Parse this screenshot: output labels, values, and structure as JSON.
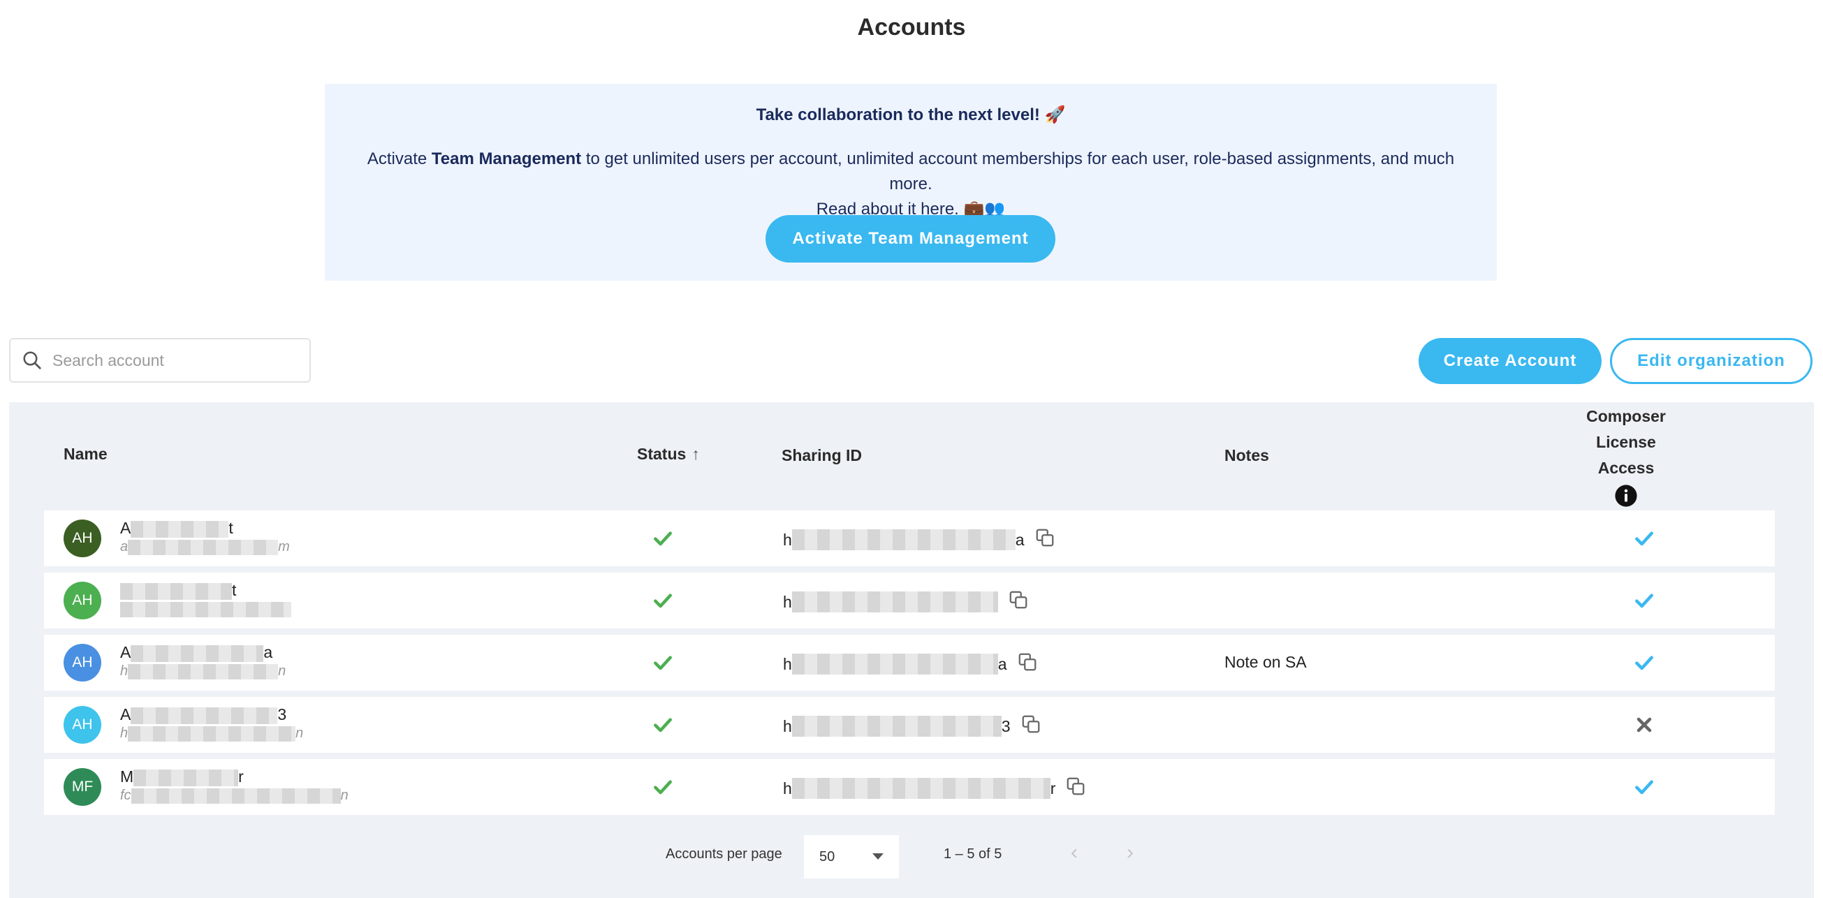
{
  "page": {
    "title": "Accounts"
  },
  "promo": {
    "heading": "Take collaboration to the next level! 🚀",
    "body_prefix": "Activate ",
    "body_bold": "Team Management",
    "body_suffix": " to get unlimited users per account, unlimited account memberships for each user, role-based assignments, and much more.",
    "link_text": "Read about it here.",
    "link_emoji": "💼👥",
    "button_label": "Activate Team Management"
  },
  "search": {
    "placeholder": "Search account",
    "value": ""
  },
  "toolbar": {
    "create_label": "Create Account",
    "edit_label": "Edit organization"
  },
  "colors": {
    "accent": "#3ab8f0",
    "check_green": "#4caf50",
    "check_blue": "#3ab8f0",
    "cross_gray": "#666666"
  },
  "table": {
    "headers": {
      "name": "Name",
      "status": "Status",
      "sharing": "Sharing ID",
      "notes": "Notes",
      "composer_l1": "Composer",
      "composer_l2": "License",
      "composer_l3": "Access"
    },
    "rows": [
      {
        "initials": "AH",
        "avatar_color": "#3b5e23",
        "name_start": "A",
        "name_end": "t",
        "email_start": "a",
        "email_end": "m",
        "status": "active",
        "sharing_start": "h",
        "sharing_end": "a",
        "notes": "",
        "composer": true
      },
      {
        "initials": "AH",
        "avatar_color": "#4caf50",
        "name_start": "",
        "name_end": "t",
        "email_start": "",
        "email_end": "",
        "status": "active",
        "sharing_start": "h",
        "sharing_end": "",
        "notes": "",
        "composer": true
      },
      {
        "initials": "AH",
        "avatar_color": "#4a90e2",
        "name_start": "A",
        "name_end": "a",
        "email_start": "h",
        "email_end": "n",
        "status": "active",
        "sharing_start": "h",
        "sharing_end": "a",
        "notes": "Note on SA",
        "composer": true
      },
      {
        "initials": "AH",
        "avatar_color": "#3ec3ec",
        "name_start": "A",
        "name_end": "3",
        "email_start": "h",
        "email_end": "n",
        "status": "active",
        "sharing_start": "h",
        "sharing_end": "3",
        "notes": "",
        "composer": false
      },
      {
        "initials": "MF",
        "avatar_color": "#2e8b57",
        "name_start": "M",
        "name_end": "r",
        "email_start": "fc",
        "email_end": "n",
        "status": "active",
        "sharing_start": "h",
        "sharing_end": "r",
        "notes": "",
        "composer": true
      }
    ]
  },
  "pagination": {
    "per_page_label": "Accounts per page",
    "per_page_value": "50",
    "range_text": "1 – 5 of 5"
  }
}
